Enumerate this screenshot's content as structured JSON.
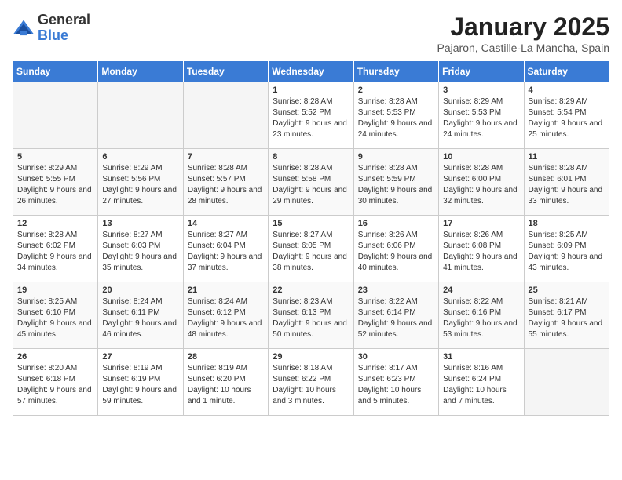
{
  "logo": {
    "general": "General",
    "blue": "Blue"
  },
  "title": "January 2025",
  "subtitle": "Pajaron, Castille-La Mancha, Spain",
  "weekdays": [
    "Sunday",
    "Monday",
    "Tuesday",
    "Wednesday",
    "Thursday",
    "Friday",
    "Saturday"
  ],
  "weeks": [
    [
      {
        "day": "",
        "empty": true
      },
      {
        "day": "",
        "empty": true
      },
      {
        "day": "",
        "empty": true
      },
      {
        "day": "1",
        "sunrise": "8:28 AM",
        "sunset": "5:52 PM",
        "daylight": "9 hours and 23 minutes."
      },
      {
        "day": "2",
        "sunrise": "8:28 AM",
        "sunset": "5:53 PM",
        "daylight": "9 hours and 24 minutes."
      },
      {
        "day": "3",
        "sunrise": "8:29 AM",
        "sunset": "5:53 PM",
        "daylight": "9 hours and 24 minutes."
      },
      {
        "day": "4",
        "sunrise": "8:29 AM",
        "sunset": "5:54 PM",
        "daylight": "9 hours and 25 minutes."
      }
    ],
    [
      {
        "day": "5",
        "sunrise": "8:29 AM",
        "sunset": "5:55 PM",
        "daylight": "9 hours and 26 minutes."
      },
      {
        "day": "6",
        "sunrise": "8:29 AM",
        "sunset": "5:56 PM",
        "daylight": "9 hours and 27 minutes."
      },
      {
        "day": "7",
        "sunrise": "8:28 AM",
        "sunset": "5:57 PM",
        "daylight": "9 hours and 28 minutes."
      },
      {
        "day": "8",
        "sunrise": "8:28 AM",
        "sunset": "5:58 PM",
        "daylight": "9 hours and 29 minutes."
      },
      {
        "day": "9",
        "sunrise": "8:28 AM",
        "sunset": "5:59 PM",
        "daylight": "9 hours and 30 minutes."
      },
      {
        "day": "10",
        "sunrise": "8:28 AM",
        "sunset": "6:00 PM",
        "daylight": "9 hours and 32 minutes."
      },
      {
        "day": "11",
        "sunrise": "8:28 AM",
        "sunset": "6:01 PM",
        "daylight": "9 hours and 33 minutes."
      }
    ],
    [
      {
        "day": "12",
        "sunrise": "8:28 AM",
        "sunset": "6:02 PM",
        "daylight": "9 hours and 34 minutes."
      },
      {
        "day": "13",
        "sunrise": "8:27 AM",
        "sunset": "6:03 PM",
        "daylight": "9 hours and 35 minutes."
      },
      {
        "day": "14",
        "sunrise": "8:27 AM",
        "sunset": "6:04 PM",
        "daylight": "9 hours and 37 minutes."
      },
      {
        "day": "15",
        "sunrise": "8:27 AM",
        "sunset": "6:05 PM",
        "daylight": "9 hours and 38 minutes."
      },
      {
        "day": "16",
        "sunrise": "8:26 AM",
        "sunset": "6:06 PM",
        "daylight": "9 hours and 40 minutes."
      },
      {
        "day": "17",
        "sunrise": "8:26 AM",
        "sunset": "6:08 PM",
        "daylight": "9 hours and 41 minutes."
      },
      {
        "day": "18",
        "sunrise": "8:25 AM",
        "sunset": "6:09 PM",
        "daylight": "9 hours and 43 minutes."
      }
    ],
    [
      {
        "day": "19",
        "sunrise": "8:25 AM",
        "sunset": "6:10 PM",
        "daylight": "9 hours and 45 minutes."
      },
      {
        "day": "20",
        "sunrise": "8:24 AM",
        "sunset": "6:11 PM",
        "daylight": "9 hours and 46 minutes."
      },
      {
        "day": "21",
        "sunrise": "8:24 AM",
        "sunset": "6:12 PM",
        "daylight": "9 hours and 48 minutes."
      },
      {
        "day": "22",
        "sunrise": "8:23 AM",
        "sunset": "6:13 PM",
        "daylight": "9 hours and 50 minutes."
      },
      {
        "day": "23",
        "sunrise": "8:22 AM",
        "sunset": "6:14 PM",
        "daylight": "9 hours and 52 minutes."
      },
      {
        "day": "24",
        "sunrise": "8:22 AM",
        "sunset": "6:16 PM",
        "daylight": "9 hours and 53 minutes."
      },
      {
        "day": "25",
        "sunrise": "8:21 AM",
        "sunset": "6:17 PM",
        "daylight": "9 hours and 55 minutes."
      }
    ],
    [
      {
        "day": "26",
        "sunrise": "8:20 AM",
        "sunset": "6:18 PM",
        "daylight": "9 hours and 57 minutes."
      },
      {
        "day": "27",
        "sunrise": "8:19 AM",
        "sunset": "6:19 PM",
        "daylight": "9 hours and 59 minutes."
      },
      {
        "day": "28",
        "sunrise": "8:19 AM",
        "sunset": "6:20 PM",
        "daylight": "10 hours and 1 minute."
      },
      {
        "day": "29",
        "sunrise": "8:18 AM",
        "sunset": "6:22 PM",
        "daylight": "10 hours and 3 minutes."
      },
      {
        "day": "30",
        "sunrise": "8:17 AM",
        "sunset": "6:23 PM",
        "daylight": "10 hours and 5 minutes."
      },
      {
        "day": "31",
        "sunrise": "8:16 AM",
        "sunset": "6:24 PM",
        "daylight": "10 hours and 7 minutes."
      },
      {
        "day": "",
        "empty": true
      }
    ]
  ]
}
